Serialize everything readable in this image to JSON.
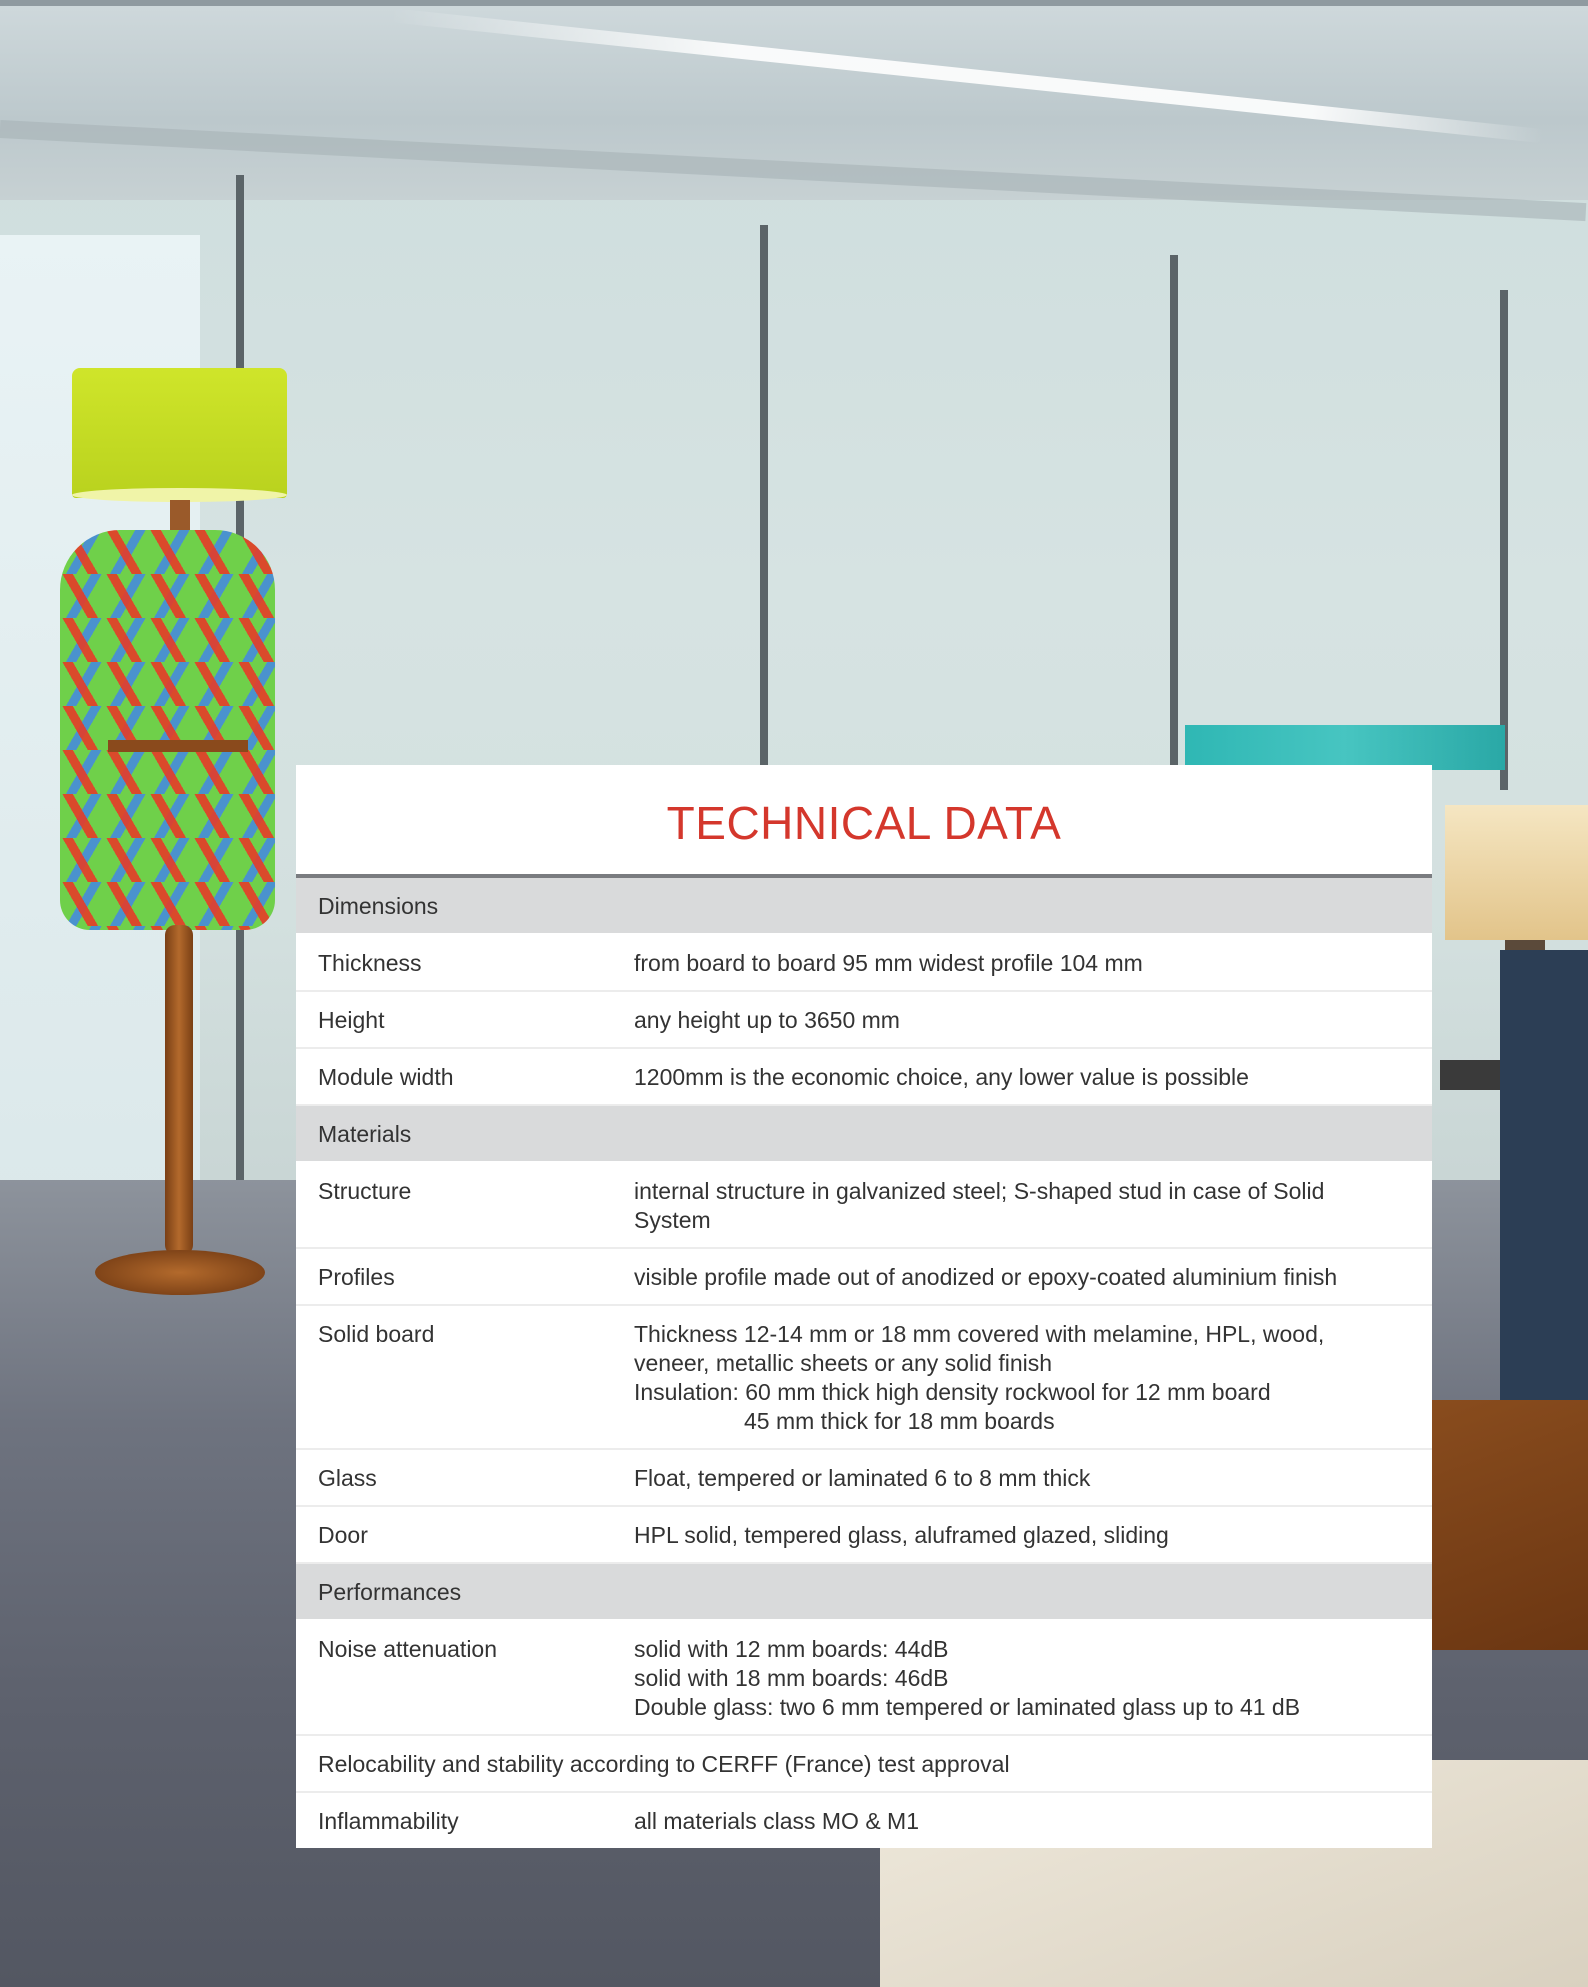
{
  "title": "TECHNICAL DATA",
  "colors": {
    "title": "#d4372c",
    "section_background": "#d9dadb",
    "rule": "#7a7c80"
  },
  "sections": [
    {
      "heading": "Dimensions",
      "rows": [
        {
          "label": "Thickness",
          "value": [
            "from board to board 95 mm widest profile 104 mm"
          ]
        },
        {
          "label": "Height",
          "value": [
            "any height up to 3650 mm"
          ]
        },
        {
          "label": "Module width",
          "value": [
            "1200mm is the economic choice, any lower value is possible"
          ]
        }
      ]
    },
    {
      "heading": "Materials",
      "rows": [
        {
          "label": "Structure",
          "value": [
            "internal structure in galvanized steel; S-shaped stud in case of Solid",
            "System"
          ]
        },
        {
          "label": "Profiles",
          "value": [
            "visible profile made out of anodized or epoxy-coated aluminium finish"
          ]
        },
        {
          "label": "Solid board",
          "value": [
            "Thickness 12-14 mm or 18 mm covered with melamine, HPL, wood,",
            "veneer, metallic sheets or any solid finish",
            "Insulation: 60 mm thick high density rockwool for 12 mm board",
            "45 mm thick for 18 mm boards"
          ]
        },
        {
          "label": "Glass",
          "value": [
            "Float, tempered or laminated 6 to 8 mm thick"
          ]
        },
        {
          "label": "Door",
          "value": [
            "HPL solid, tempered glass, aluframed glazed, sliding"
          ]
        }
      ]
    },
    {
      "heading": "Performances",
      "rows": [
        {
          "label": "Noise attenuation",
          "value": [
            "solid with 12 mm boards: 44dB",
            "solid with 18 mm boards: 46dB",
            "Double glass: two 6 mm tempered or laminated glass up to 41 dB"
          ]
        }
      ]
    }
  ],
  "full_row": "Relocability and stability according to CERFF (France) test approval",
  "last_row": {
    "label": "Inflammability",
    "value": "all materials class MO & M1"
  }
}
